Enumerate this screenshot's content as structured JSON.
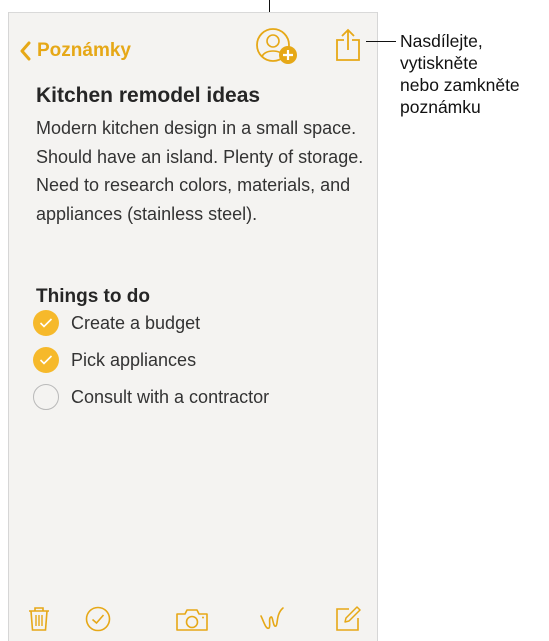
{
  "nav": {
    "back_label": "Poznámky",
    "accent": "#e6a817",
    "icons": [
      "chevron-left-icon",
      "add-person-icon",
      "share-icon"
    ]
  },
  "note": {
    "title": "Kitchen remodel ideas",
    "body": "Modern kitchen design in a small space. Should have an island. Plenty of storage. Need to research colors, materials, and appliances (stainless steel).",
    "subheading": "Things to do",
    "checklist": [
      {
        "label": "Create a budget",
        "checked": true
      },
      {
        "label": "Pick appliances",
        "checked": true
      },
      {
        "label": "Consult with a contractor",
        "checked": false
      }
    ]
  },
  "toolbar": {
    "icons": [
      "trash-icon",
      "checklist-icon",
      "camera-icon",
      "sketch-icon",
      "compose-icon"
    ]
  },
  "callout": {
    "text": "Nasdílejte,\nvytiskněte\nnebo zamkněte\npoznámku"
  },
  "colors": {
    "accent": "#e6a817",
    "check_fill": "#f6b92b",
    "paper": "#f4f3f1"
  }
}
